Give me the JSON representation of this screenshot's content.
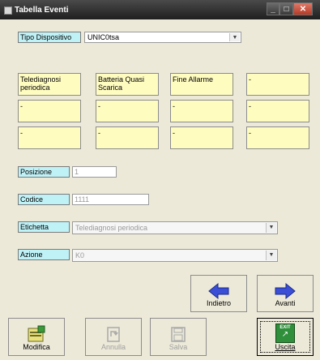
{
  "window": {
    "title": "Tabella Eventi"
  },
  "tipo_dispositivo": {
    "label": "Tipo Dispositivo",
    "value": "UNIC0tsa"
  },
  "events": [
    "Telediagnosi periodica",
    "Batteria Quasi Scarica",
    "Fine Allarme",
    "-",
    "-",
    "-",
    "-",
    "-",
    "-",
    "-",
    "-",
    "-"
  ],
  "posizione": {
    "label": "Posizione",
    "value": "1"
  },
  "codice": {
    "label": "Codice",
    "value": "1111"
  },
  "etichetta": {
    "label": "Etichetta",
    "value": "Telediagnosi periodica"
  },
  "azione": {
    "label": "Azione",
    "value": "K0"
  },
  "buttons": {
    "indietro": "Indietro",
    "avanti": "Avanti",
    "modifica": "Modifica",
    "annulla": "Annulla",
    "salva": "Salva",
    "uscita": "Uscita",
    "exit_icon_text": "EXIT"
  },
  "colors": {
    "label_cyan": "#bff2f7",
    "event_yellow": "#fffcc0",
    "arrow_blue": "#3b4fd6"
  }
}
